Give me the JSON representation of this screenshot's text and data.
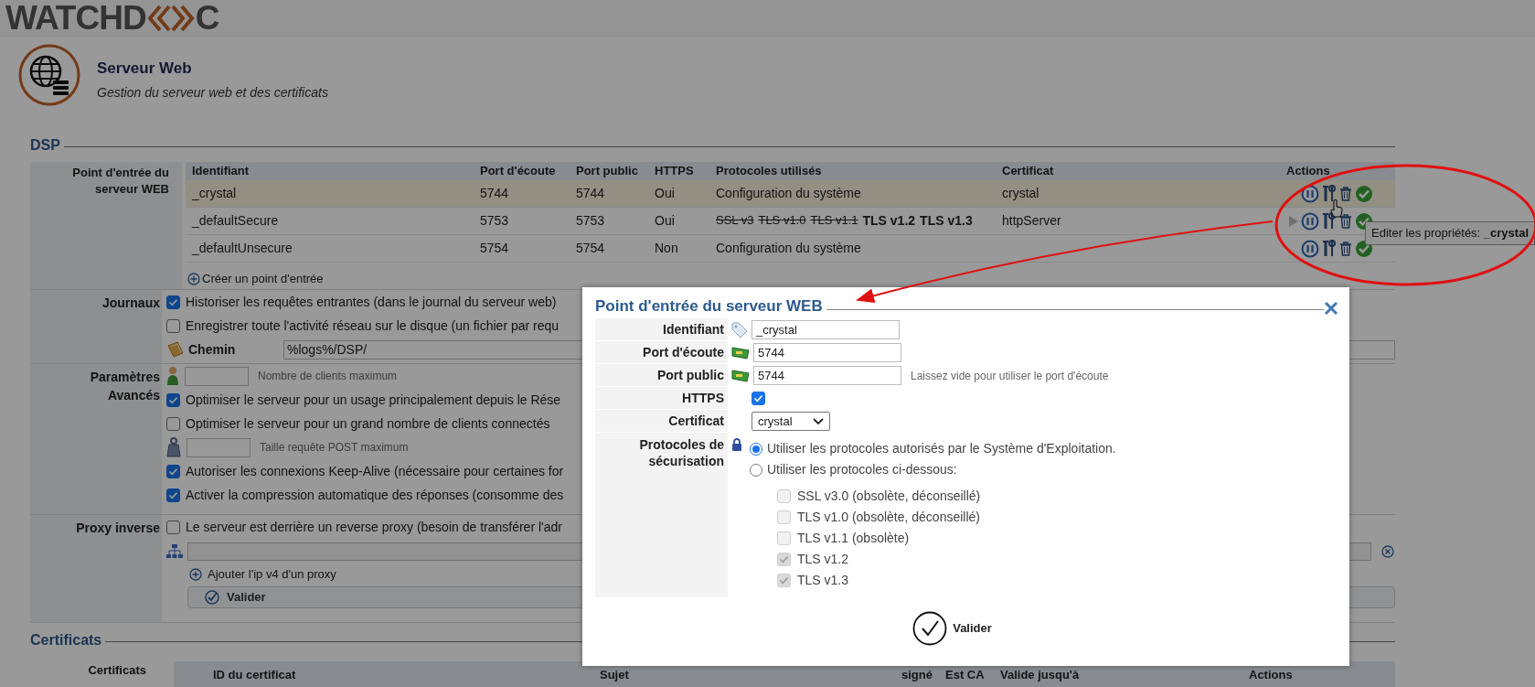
{
  "logo": {
    "left": "WATCHD",
    "right": "C"
  },
  "page": {
    "title": "Serveur Web",
    "subtitle": "Gestion du serveur web et des certificats"
  },
  "dsp": {
    "legend": "DSP",
    "entry_label": "Point d'entrée du serveur WEB",
    "columns": [
      "Identifiant",
      "Port d'écoute",
      "Port public",
      "HTTPS",
      "Protocoles utilisés",
      "Certificat",
      "Actions"
    ],
    "rows": [
      {
        "id": "_crystal",
        "listen_port": "5744",
        "public_port": "5744",
        "https": "Oui",
        "protocols": [
          {
            "text": "Configuration du système",
            "kind": "system"
          }
        ],
        "certificate": "crystal",
        "selected": true,
        "play_icon": false
      },
      {
        "id": "_defaultSecure",
        "listen_port": "5753",
        "public_port": "5753",
        "https": "Oui",
        "protocols": [
          {
            "text": "SSL v3",
            "kind": "deprecated"
          },
          {
            "text": "TLS v1.0",
            "kind": "deprecated"
          },
          {
            "text": "TLS v1.1",
            "kind": "deprecated"
          },
          {
            "text": "TLS v1.2",
            "kind": "enabled"
          },
          {
            "text": "TLS v1.3",
            "kind": "enabled"
          }
        ],
        "certificate": "httpServer",
        "selected": false,
        "play_icon": true
      },
      {
        "id": "_defaultUnsecure",
        "listen_port": "5754",
        "public_port": "5754",
        "https": "Non",
        "protocols": [
          {
            "text": "Configuration du système",
            "kind": "system"
          }
        ],
        "certificate": "",
        "selected": false,
        "play_icon": false
      }
    ],
    "create_link": "Créer un point d'entrée"
  },
  "settings": [
    {
      "label": "Journaux",
      "items": [
        {
          "kind": "checkbox",
          "label": "Historiser les requêtes entrantes (dans le journal du serveur web)",
          "checked": true
        },
        {
          "kind": "checkbox",
          "label": "Enregistrer toute l'activité réseau sur le disque (un fichier par requ",
          "checked": false
        },
        {
          "kind": "path",
          "label": "Chemin",
          "value": "%logs%/DSP/"
        }
      ]
    },
    {
      "label": "Paramètres Avancés",
      "items": [
        {
          "kind": "clients",
          "label": "Nombre de clients maximum"
        },
        {
          "kind": "checkbox",
          "label": "Optimiser le serveur pour un usage principalement depuis le Rése",
          "checked": true
        },
        {
          "kind": "checkbox",
          "label": "Optimiser le serveur pour un grand nombre de clients connectés",
          "checked": false
        },
        {
          "kind": "post_size",
          "label": "Taille requête POST maximum"
        },
        {
          "kind": "checkbox",
          "label": "Autoriser les connexions Keep-Alive (nécessaire pour certaines for",
          "checked": true
        },
        {
          "kind": "checkbox",
          "label": "Activer la compression automatique des réponses (consomme des",
          "checked": true
        }
      ]
    },
    {
      "label": "Proxy inverse",
      "items": [
        {
          "kind": "checkbox",
          "label": "Le serveur est derrière un reverse proxy (besoin de transférer l'adr",
          "checked": false
        },
        {
          "kind": "list_field"
        },
        {
          "kind": "add_link",
          "label": "Ajouter l'ip v4 d'un proxy"
        },
        {
          "kind": "submit",
          "label": "Valider"
        }
      ]
    }
  ],
  "tooltip": "Editer les propriétés: **_crystal**",
  "certificates": {
    "legend": "Certificats",
    "label": "Certificats",
    "columns": [
      "ID du certificat",
      "Sujet",
      "signé",
      "Est CA",
      "Valide jusqu'à",
      "Actions"
    ]
  },
  "dialog": {
    "title": "Point d'entrée du serveur WEB",
    "fields": [
      {
        "kind": "text",
        "label": "Identifiant",
        "value": "_crystal"
      },
      {
        "kind": "port",
        "label": "Port d'écoute",
        "value": "5744"
      },
      {
        "kind": "port",
        "label": "Port public",
        "value": "5744",
        "hint": "Laissez vide pour utiliser le port d'écoute"
      },
      {
        "kind": "checkbox",
        "label": "HTTPS",
        "checked": true
      },
      {
        "kind": "select",
        "label": "Certificat",
        "value": "crystal"
      },
      {
        "kind": "protocols",
        "label": "Protocoles de sécurisation",
        "options": [
          {
            "label": "Utiliser les protocoles autorisés par le Système d'Exploitation.",
            "selected": true
          },
          {
            "label": "Utiliser les protocoles ci-dessous:",
            "selected": false
          }
        ],
        "protocols": [
          {
            "label": "SSL v3.0 (obsolète, déconseillé)",
            "checked": false,
            "disabled": true
          },
          {
            "label": "TLS v1.0 (obsolète, déconseillé)",
            "checked": false,
            "disabled": true
          },
          {
            "label": "TLS v1.1 (obsolète)",
            "checked": false,
            "disabled": true
          },
          {
            "label": "TLS v1.2",
            "checked": true,
            "disabled": true
          },
          {
            "label": "TLS v1.3",
            "checked": true,
            "disabled": true
          }
        ]
      }
    ],
    "submit": "Valider"
  }
}
